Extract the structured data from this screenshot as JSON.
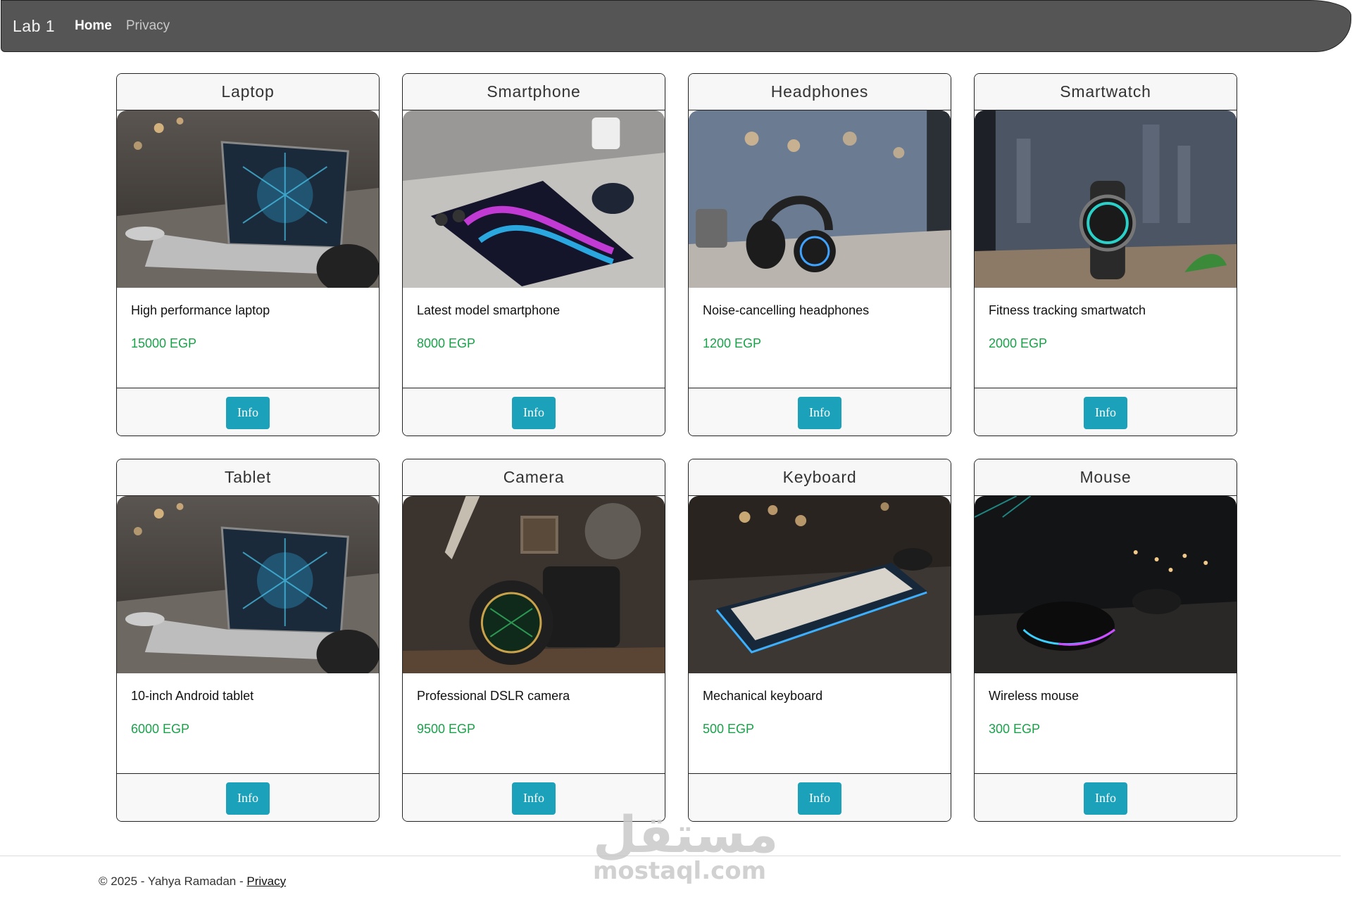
{
  "navbar": {
    "brand": "Lab 1",
    "links": [
      {
        "label": "Home",
        "active": true
      },
      {
        "label": "Privacy",
        "active": false
      }
    ]
  },
  "products": [
    {
      "title": "Laptop",
      "description": "High performance laptop",
      "price": "15000 EGP",
      "button": "Info",
      "image": "laptop-photo"
    },
    {
      "title": "Smartphone",
      "description": "Latest model smartphone",
      "price": "8000 EGP",
      "button": "Info",
      "image": "smartphone-photo"
    },
    {
      "title": "Headphones",
      "description": "Noise-cancelling headphones",
      "price": "1200 EGP",
      "button": "Info",
      "image": "headphones-photo"
    },
    {
      "title": "Smartwatch",
      "description": "Fitness tracking smartwatch",
      "price": "2000 EGP",
      "button": "Info",
      "image": "smartwatch-photo"
    },
    {
      "title": "Tablet",
      "description": "10-inch Android tablet",
      "price": "6000 EGP",
      "button": "Info",
      "image": "laptop-photo"
    },
    {
      "title": "Camera",
      "description": "Professional DSLR camera",
      "price": "9500 EGP",
      "button": "Info",
      "image": "camera-photo"
    },
    {
      "title": "Keyboard",
      "description": "Mechanical keyboard",
      "price": "500 EGP",
      "button": "Info",
      "image": "keyboard-photo"
    },
    {
      "title": "Mouse",
      "description": "Wireless mouse",
      "price": "300 EGP",
      "button": "Info",
      "image": "mouse-photo"
    }
  ],
  "footer": {
    "text": "© 2025 - Yahya Ramadan - ",
    "link": "Privacy"
  },
  "watermark": {
    "arabic": "مستقل",
    "latin": "mostaql.com"
  },
  "colors": {
    "navbar": "#555555",
    "price": "#19a24a",
    "button": "#1ba1b9"
  }
}
